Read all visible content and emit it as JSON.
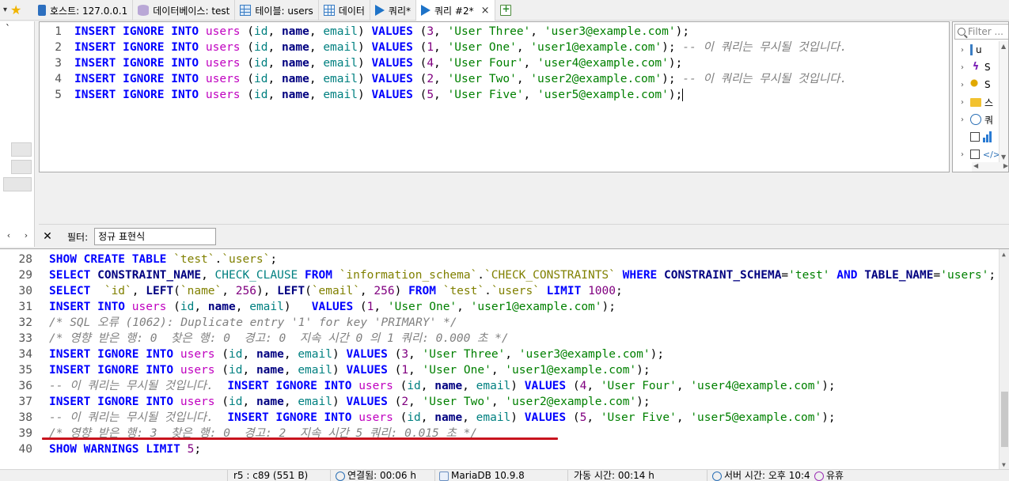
{
  "tabs": [
    {
      "label": "호스트: 127.0.0.1",
      "icon": "host-icon"
    },
    {
      "label": "데이터베이스: test",
      "icon": "database-icon"
    },
    {
      "label": "테이블: users",
      "icon": "table-icon"
    },
    {
      "label": "데이터",
      "icon": "data-grid-icon"
    },
    {
      "label": "쿼리*",
      "icon": "query-play-icon"
    },
    {
      "label": "쿼리 #2*",
      "icon": "query-play-icon",
      "active": true,
      "close": "×"
    }
  ],
  "left_tree": {
    "tick": "`"
  },
  "left_nav": {
    "prev": "‹",
    "next": "›"
  },
  "helper": {
    "filter_placeholder": "Filter ...",
    "items": [
      "u",
      "S",
      "S",
      "스",
      "쿼",
      "",
      ""
    ]
  },
  "filter": {
    "close": "✕",
    "label": "필터:",
    "value": "정규 표현식"
  },
  "editor": {
    "lines": [
      {
        "n": "1",
        "sql": [
          [
            "kw",
            "INSERT IGNORE INTO "
          ],
          [
            "tbl",
            "users"
          ],
          [
            "pun",
            " ("
          ],
          [
            "fld",
            "id"
          ],
          [
            "pun",
            ", "
          ],
          [
            "col",
            "name"
          ],
          [
            "pun",
            ", "
          ],
          [
            "fld",
            "email"
          ],
          [
            "pun",
            ") "
          ],
          [
            "kw",
            "VALUES"
          ],
          [
            "pun",
            " ("
          ],
          [
            "num",
            "3"
          ],
          [
            "pun",
            ", "
          ],
          [
            "str",
            "'User Three'"
          ],
          [
            "pun",
            ", "
          ],
          [
            "str",
            "'user3@example.com'"
          ],
          [
            "pun",
            ");"
          ]
        ]
      },
      {
        "n": "2",
        "sql": [
          [
            "kw",
            "INSERT IGNORE INTO "
          ],
          [
            "tbl",
            "users"
          ],
          [
            "pun",
            " ("
          ],
          [
            "fld",
            "id"
          ],
          [
            "pun",
            ", "
          ],
          [
            "col",
            "name"
          ],
          [
            "pun",
            ", "
          ],
          [
            "fld",
            "email"
          ],
          [
            "pun",
            ") "
          ],
          [
            "kw",
            "VALUES"
          ],
          [
            "pun",
            " ("
          ],
          [
            "num",
            "1"
          ],
          [
            "pun",
            ", "
          ],
          [
            "str",
            "'User One'"
          ],
          [
            "pun",
            ", "
          ],
          [
            "str",
            "'user1@example.com'"
          ],
          [
            "pun",
            ");"
          ],
          [
            "com",
            " -- 이 쿼리는 무시될 것입니다."
          ]
        ]
      },
      {
        "n": "3",
        "sql": [
          [
            "kw",
            "INSERT IGNORE INTO "
          ],
          [
            "tbl",
            "users"
          ],
          [
            "pun",
            " ("
          ],
          [
            "fld",
            "id"
          ],
          [
            "pun",
            ", "
          ],
          [
            "col",
            "name"
          ],
          [
            "pun",
            ", "
          ],
          [
            "fld",
            "email"
          ],
          [
            "pun",
            ") "
          ],
          [
            "kw",
            "VALUES"
          ],
          [
            "pun",
            " ("
          ],
          [
            "num",
            "4"
          ],
          [
            "pun",
            ", "
          ],
          [
            "str",
            "'User Four'"
          ],
          [
            "pun",
            ", "
          ],
          [
            "str",
            "'user4@example.com'"
          ],
          [
            "pun",
            ");"
          ]
        ]
      },
      {
        "n": "4",
        "sql": [
          [
            "kw",
            "INSERT IGNORE INTO "
          ],
          [
            "tbl",
            "users"
          ],
          [
            "pun",
            " ("
          ],
          [
            "fld",
            "id"
          ],
          [
            "pun",
            ", "
          ],
          [
            "col",
            "name"
          ],
          [
            "pun",
            ", "
          ],
          [
            "fld",
            "email"
          ],
          [
            "pun",
            ") "
          ],
          [
            "kw",
            "VALUES"
          ],
          [
            "pun",
            " ("
          ],
          [
            "num",
            "2"
          ],
          [
            "pun",
            ", "
          ],
          [
            "str",
            "'User Two'"
          ],
          [
            "pun",
            ", "
          ],
          [
            "str",
            "'user2@example.com'"
          ],
          [
            "pun",
            ");"
          ],
          [
            "com",
            " -- 이 쿼리는 무시될 것입니다."
          ]
        ]
      },
      {
        "n": "5",
        "sql": [
          [
            "kw",
            "INSERT IGNORE INTO "
          ],
          [
            "tbl",
            "users"
          ],
          [
            "pun",
            " ("
          ],
          [
            "fld",
            "id"
          ],
          [
            "pun",
            ", "
          ],
          [
            "col",
            "name"
          ],
          [
            "pun",
            ", "
          ],
          [
            "fld",
            "email"
          ],
          [
            "pun",
            ") "
          ],
          [
            "kw",
            "VALUES"
          ],
          [
            "pun",
            " ("
          ],
          [
            "num",
            "5"
          ],
          [
            "pun",
            ", "
          ],
          [
            "str",
            "'User Five'"
          ],
          [
            "pun",
            ", "
          ],
          [
            "str",
            "'user5@example.com'"
          ],
          [
            "pun",
            ");"
          ]
        ]
      }
    ]
  },
  "log": {
    "lines": [
      {
        "n": "28",
        "sql": [
          [
            "kw",
            "SHOW CREATE TABLE "
          ],
          [
            "bq",
            "`test`"
          ],
          [
            "pun",
            "."
          ],
          [
            "bq",
            "`users`"
          ],
          [
            "pun",
            ";"
          ]
        ]
      },
      {
        "n": "29",
        "sql": [
          [
            "kw",
            "SELECT "
          ],
          [
            "col",
            "CONSTRAINT_NAME"
          ],
          [
            "pun",
            ", "
          ],
          [
            "fld",
            "CHECK_CLAUSE"
          ],
          [
            "kw",
            " FROM "
          ],
          [
            "bq",
            "`information_schema`"
          ],
          [
            "pun",
            "."
          ],
          [
            "bq",
            "`CHECK_CONSTRAINTS`"
          ],
          [
            "kw",
            " WHERE "
          ],
          [
            "col",
            "CONSTRAINT_SCHEMA"
          ],
          [
            "pun",
            "="
          ],
          [
            "str",
            "'test'"
          ],
          [
            "kw",
            " AND "
          ],
          [
            "col",
            "TABLE_NAME"
          ],
          [
            "pun",
            "="
          ],
          [
            "str",
            "'users'"
          ],
          [
            "pun",
            ";"
          ]
        ]
      },
      {
        "n": "30",
        "sql": [
          [
            "kw",
            "SELECT  "
          ],
          [
            "bq",
            "`id`"
          ],
          [
            "pun",
            ", "
          ],
          [
            "fn",
            "LEFT"
          ],
          [
            "pun",
            "("
          ],
          [
            "bq",
            "`name`"
          ],
          [
            "pun",
            ", "
          ],
          [
            "num",
            "256"
          ],
          [
            "pun",
            "), "
          ],
          [
            "fn",
            "LEFT"
          ],
          [
            "pun",
            "("
          ],
          [
            "bq",
            "`email`"
          ],
          [
            "pun",
            ", "
          ],
          [
            "num",
            "256"
          ],
          [
            "pun",
            ") "
          ],
          [
            "kw",
            "FROM "
          ],
          [
            "bq",
            "`test`"
          ],
          [
            "pun",
            "."
          ],
          [
            "bq",
            "`users`"
          ],
          [
            "kw",
            " LIMIT "
          ],
          [
            "num",
            "1000"
          ],
          [
            "pun",
            ";"
          ]
        ]
      },
      {
        "n": "31",
        "sql": [
          [
            "kw",
            "INSERT INTO "
          ],
          [
            "tbl",
            "users"
          ],
          [
            "pun",
            " ("
          ],
          [
            "fld",
            "id"
          ],
          [
            "pun",
            ", "
          ],
          [
            "col",
            "name"
          ],
          [
            "pun",
            ", "
          ],
          [
            "fld",
            "email"
          ],
          [
            "pun",
            ")   "
          ],
          [
            "kw",
            "VALUES"
          ],
          [
            "pun",
            " ("
          ],
          [
            "num",
            "1"
          ],
          [
            "pun",
            ", "
          ],
          [
            "str",
            "'User One'"
          ],
          [
            "pun",
            ", "
          ],
          [
            "str",
            "'user1@example.com'"
          ],
          [
            "pun",
            ");"
          ]
        ]
      },
      {
        "n": "32",
        "sql": [
          [
            "com",
            "/* SQL 오류 (1062): Duplicate entry '1' for key 'PRIMARY' */"
          ]
        ]
      },
      {
        "n": "33",
        "sql": [
          [
            "com",
            "/* 영향 받은 행: 0  찾은 행: 0  경고: 0  지속 시간 0 의 1 쿼리: 0.000 초 */"
          ]
        ]
      },
      {
        "n": "34",
        "sql": [
          [
            "kw",
            "INSERT IGNORE INTO "
          ],
          [
            "tbl",
            "users"
          ],
          [
            "pun",
            " ("
          ],
          [
            "fld",
            "id"
          ],
          [
            "pun",
            ", "
          ],
          [
            "col",
            "name"
          ],
          [
            "pun",
            ", "
          ],
          [
            "fld",
            "email"
          ],
          [
            "pun",
            ") "
          ],
          [
            "kw",
            "VALUES"
          ],
          [
            "pun",
            " ("
          ],
          [
            "num",
            "3"
          ],
          [
            "pun",
            ", "
          ],
          [
            "str",
            "'User Three'"
          ],
          [
            "pun",
            ", "
          ],
          [
            "str",
            "'user3@example.com'"
          ],
          [
            "pun",
            ");"
          ]
        ]
      },
      {
        "n": "35",
        "sql": [
          [
            "kw",
            "INSERT IGNORE INTO "
          ],
          [
            "tbl",
            "users"
          ],
          [
            "pun",
            " ("
          ],
          [
            "fld",
            "id"
          ],
          [
            "pun",
            ", "
          ],
          [
            "col",
            "name"
          ],
          [
            "pun",
            ", "
          ],
          [
            "fld",
            "email"
          ],
          [
            "pun",
            ") "
          ],
          [
            "kw",
            "VALUES"
          ],
          [
            "pun",
            " ("
          ],
          [
            "num",
            "1"
          ],
          [
            "pun",
            ", "
          ],
          [
            "str",
            "'User One'"
          ],
          [
            "pun",
            ", "
          ],
          [
            "str",
            "'user1@example.com'"
          ],
          [
            "pun",
            ");"
          ]
        ]
      },
      {
        "n": "36",
        "sql": [
          [
            "com",
            "-- 이 쿼리는 무시될 것입니다.  "
          ],
          [
            "kw",
            "INSERT IGNORE INTO "
          ],
          [
            "tbl",
            "users"
          ],
          [
            "pun",
            " ("
          ],
          [
            "fld",
            "id"
          ],
          [
            "pun",
            ", "
          ],
          [
            "col",
            "name"
          ],
          [
            "pun",
            ", "
          ],
          [
            "fld",
            "email"
          ],
          [
            "pun",
            ") "
          ],
          [
            "kw",
            "VALUES"
          ],
          [
            "pun",
            " ("
          ],
          [
            "num",
            "4"
          ],
          [
            "pun",
            ", "
          ],
          [
            "str",
            "'User Four'"
          ],
          [
            "pun",
            ", "
          ],
          [
            "str",
            "'user4@example.com'"
          ],
          [
            "pun",
            ");"
          ]
        ]
      },
      {
        "n": "37",
        "sql": [
          [
            "kw",
            "INSERT IGNORE INTO "
          ],
          [
            "tbl",
            "users"
          ],
          [
            "pun",
            " ("
          ],
          [
            "fld",
            "id"
          ],
          [
            "pun",
            ", "
          ],
          [
            "col",
            "name"
          ],
          [
            "pun",
            ", "
          ],
          [
            "fld",
            "email"
          ],
          [
            "pun",
            ") "
          ],
          [
            "kw",
            "VALUES"
          ],
          [
            "pun",
            " ("
          ],
          [
            "num",
            "2"
          ],
          [
            "pun",
            ", "
          ],
          [
            "str",
            "'User Two'"
          ],
          [
            "pun",
            ", "
          ],
          [
            "str",
            "'user2@example.com'"
          ],
          [
            "pun",
            ");"
          ]
        ]
      },
      {
        "n": "38",
        "sql": [
          [
            "com",
            "-- 이 쿼리는 무시될 것입니다.  "
          ],
          [
            "kw",
            "INSERT IGNORE INTO "
          ],
          [
            "tbl",
            "users"
          ],
          [
            "pun",
            " ("
          ],
          [
            "fld",
            "id"
          ],
          [
            "pun",
            ", "
          ],
          [
            "col",
            "name"
          ],
          [
            "pun",
            ", "
          ],
          [
            "fld",
            "email"
          ],
          [
            "pun",
            ") "
          ],
          [
            "kw",
            "VALUES"
          ],
          [
            "pun",
            " ("
          ],
          [
            "num",
            "5"
          ],
          [
            "pun",
            ", "
          ],
          [
            "str",
            "'User Five'"
          ],
          [
            "pun",
            ", "
          ],
          [
            "str",
            "'user5@example.com'"
          ],
          [
            "pun",
            ");"
          ]
        ]
      },
      {
        "n": "39",
        "sql": [
          [
            "com",
            "/* 영향 받은 행: 3  찾은 행: 0  경고: 2  지속 시간 5 쿼리: 0.015 초 */"
          ]
        ]
      },
      {
        "n": "40",
        "sql": [
          [
            "kw",
            "SHOW WARNINGS LIMIT "
          ],
          [
            "num",
            "5"
          ],
          [
            "pun",
            ";"
          ]
        ]
      }
    ]
  },
  "status": {
    "position": "r5 : c89 (551 B)",
    "connected": "연결됨: 00:06 h",
    "server": "MariaDB 10.9.8",
    "uptime": "가동 시간: 00:14 h",
    "server_time": "서버 시간: 오후 10:4",
    "idle": "유휴"
  },
  "colors": {
    "keyword": "#0000ff",
    "table": "#c000c0",
    "string": "#008000",
    "number": "#800080",
    "comment": "#808080",
    "highlight_underline": "#c8141e"
  }
}
